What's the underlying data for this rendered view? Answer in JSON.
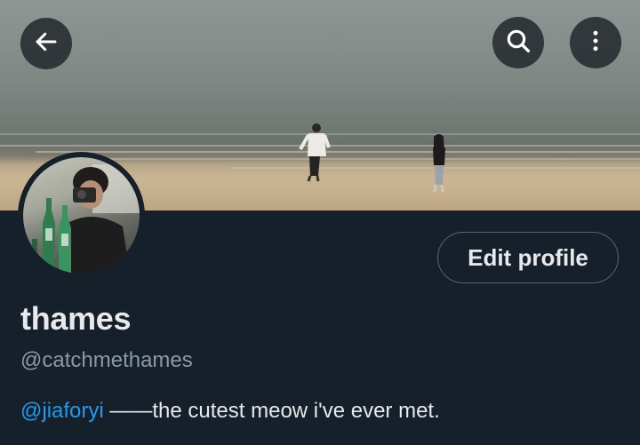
{
  "profile": {
    "display_name": "thames",
    "handle": "@catchmethames",
    "bio": {
      "mention": "@jiaforyi",
      "text": " ——the cutest meow i've ever met."
    },
    "edit_button_label": "Edit profile"
  },
  "icons": {
    "back": "arrow-left-icon",
    "search": "search-icon",
    "more": "more-vertical-icon"
  },
  "colors": {
    "background": "#15202b",
    "text_primary": "#e7e9ea",
    "text_secondary": "#8b98a5",
    "link": "#1d9bf0",
    "button_border": "#536471"
  }
}
